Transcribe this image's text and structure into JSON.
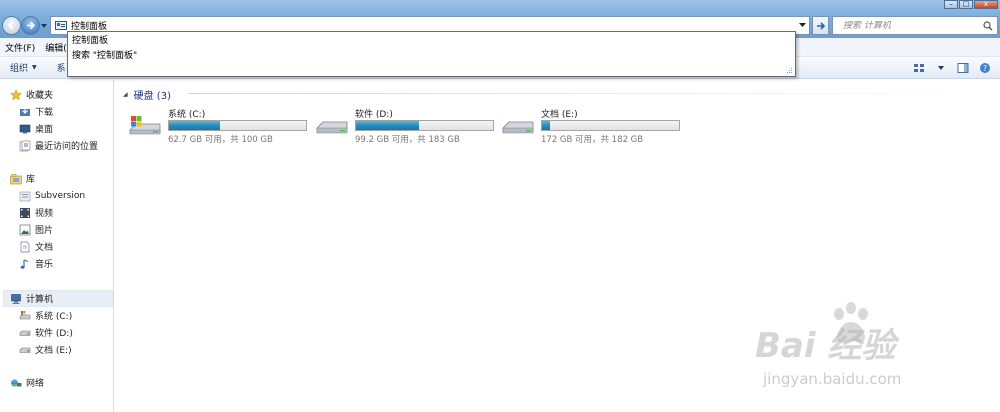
{
  "window": {
    "minimize": "–",
    "maximize": "□",
    "close": "x"
  },
  "address": {
    "path": "控制面板"
  },
  "search": {
    "placeholder": "搜索 计算机"
  },
  "menu": {
    "file": "文件(F)",
    "edit": "编辑(E)"
  },
  "toolbar": {
    "organize": "组织",
    "partial": "系"
  },
  "suggestions": [
    "控制面板",
    "搜索 \"控制面板\""
  ],
  "sidebar": {
    "favorites": "收藏夹",
    "fav_items": [
      "下载",
      "桌面",
      "最近访问的位置"
    ],
    "library": "库",
    "lib_items": [
      "Subversion",
      "视频",
      "图片",
      "文档",
      "音乐"
    ],
    "computer": "计算机",
    "computer_items": [
      "系统 (C:)",
      "软件 (D:)",
      "文档 (E:)"
    ],
    "network": "网络"
  },
  "content": {
    "group_title": "硬盘 (3)",
    "drives": [
      {
        "name": "系统 (C:)",
        "info": "62.7 GB 可用，共 100 GB",
        "used_fraction": 0.373,
        "icon": "windows-drive-icon"
      },
      {
        "name": "软件 (D:)",
        "info": "99.2 GB 可用，共 183 GB",
        "used_fraction": 0.458,
        "icon": "hard-drive-icon"
      },
      {
        "name": "文档 (E:)",
        "info": "172 GB 可用，共 182 GB",
        "used_fraction": 0.055,
        "icon": "hard-drive-icon"
      }
    ]
  },
  "watermark": {
    "brand": "Bai 经验",
    "url": "jingyan.baidu.com"
  },
  "colors": {
    "accent": "#1e3287",
    "bar_fill": "#2a8fbf",
    "title_bar": "#7fb0dc"
  }
}
